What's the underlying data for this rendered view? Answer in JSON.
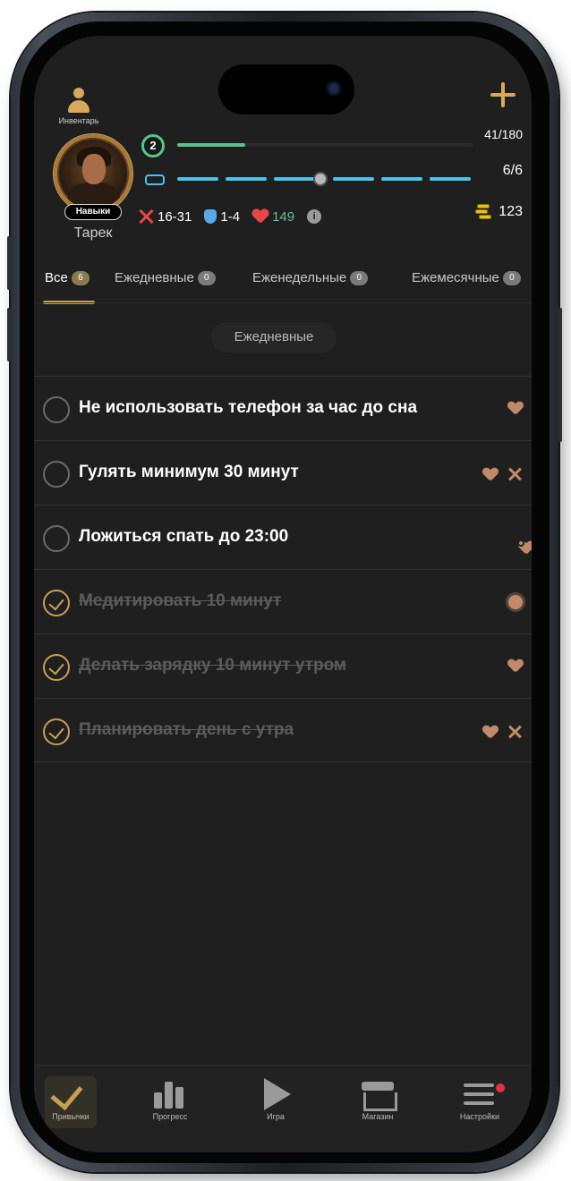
{
  "header": {
    "inventory_label": "Инвентарь",
    "hero_name": "Тарек",
    "skills_label": "Навыки",
    "level": "2",
    "xp_text": "41/180",
    "xp_progress": 0.23,
    "energy_text": "6/6",
    "attack": "16-31",
    "defense": "1-4",
    "health": "149",
    "info_icon": "i",
    "gold": "123"
  },
  "tabs": [
    {
      "label": "Все",
      "count": "6"
    },
    {
      "label": "Ежедневные",
      "count": "0"
    },
    {
      "label": "Еженедельные",
      "count": "0"
    },
    {
      "label": "Ежемесячные",
      "count": "0"
    }
  ],
  "section_label": "Ежедневные",
  "habits": [
    {
      "text": "Не использовать телефон за час до сна",
      "done": false,
      "icons": [
        "heart-icon"
      ]
    },
    {
      "text": "Гулять минимум 30 минут",
      "done": false,
      "icons": [
        "heart-icon",
        "crossed-swords-icon"
      ]
    },
    {
      "text": "Ложиться спать до 23:00",
      "done": false,
      "icons": [
        "heart-gear-icon"
      ]
    },
    {
      "text": "Медитировать 10 минут",
      "done": true,
      "icons": [
        "burst-icon"
      ]
    },
    {
      "text": "Делать зарядку 10 минут утром",
      "done": true,
      "icons": [
        "heart-icon"
      ]
    },
    {
      "text": "Планировать день с утра",
      "done": true,
      "icons": [
        "heart-icon",
        "crossed-swords-icon"
      ]
    }
  ],
  "nav": {
    "habits": "Привычки",
    "progress": "Прогресс",
    "game": "Игра",
    "store": "Магазин",
    "settings": "Настройки"
  },
  "colors": {
    "accent_gold": "#c99d55",
    "xp_green": "#5ec28c",
    "energy_blue": "#4cc3e8",
    "health_red": "#e64848"
  }
}
